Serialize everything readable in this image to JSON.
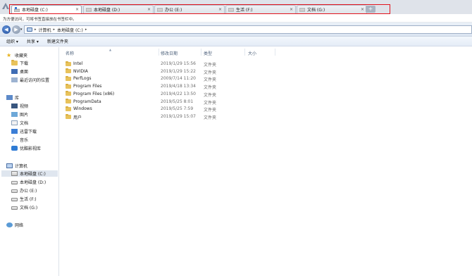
{
  "tabs": [
    {
      "label": "本地磁盘 (C:)",
      "active": true
    },
    {
      "label": "本地磁盘 (D:)",
      "active": false
    },
    {
      "label": "办公 (E:)",
      "active": false
    },
    {
      "label": "生活 (F:)",
      "active": false
    },
    {
      "label": "文档 (G:)",
      "active": false
    }
  ],
  "tab_close_glyph": "×",
  "new_tab_glyph": "+",
  "bookmark_hint": "为方便访问，可将书签直接放在书签栏中。",
  "address": {
    "crumbs": [
      "计算机",
      "本地磁盘 (C:)"
    ],
    "separator": "▸",
    "back_glyph": "◀",
    "forward_glyph": "▶",
    "history_glyph": "▾"
  },
  "toolbar": {
    "organize": "组织 ▾",
    "share": "共享 ▾",
    "new_folder": "新建文件夹"
  },
  "sidebar": {
    "favorites": "收藏夹",
    "downloads": "下载",
    "desktop": "桌面",
    "recent": "最近访问的位置",
    "library": "库",
    "video": "视频",
    "pictures": "图片",
    "documents": "文档",
    "thunder": "迅雷下载",
    "music": "音乐",
    "youku": "优酷影视库",
    "computer": "计算机",
    "drive_c": "本地磁盘 (C:)",
    "drive_d": "本地磁盘 (D:)",
    "drive_e": "办公 (E:)",
    "drive_f": "生活 (F:)",
    "drive_g": "文档 (G:)",
    "network": "网络"
  },
  "columns": {
    "name": "名称",
    "modified": "修改日期",
    "type": "类型",
    "size": "大小",
    "sort_glyph": "▲"
  },
  "files": [
    {
      "name": "Intel",
      "modified": "2019/1/29 15:56",
      "type": "文件夹"
    },
    {
      "name": "NVIDIA",
      "modified": "2019/1/29 15:22",
      "type": "文件夹"
    },
    {
      "name": "PerfLogs",
      "modified": "2009/7/14 11:20",
      "type": "文件夹"
    },
    {
      "name": "Program Files",
      "modified": "2019/4/18 13:34",
      "type": "文件夹"
    },
    {
      "name": "Program Files (x86)",
      "modified": "2019/4/22 13:50",
      "type": "文件夹"
    },
    {
      "name": "ProgramData",
      "modified": "2019/5/25 8:01",
      "type": "文件夹"
    },
    {
      "name": "Windows",
      "modified": "2019/5/25 7:59",
      "type": "文件夹"
    },
    {
      "name": "用户",
      "modified": "2019/1/29 15:07",
      "type": "文件夹"
    }
  ]
}
